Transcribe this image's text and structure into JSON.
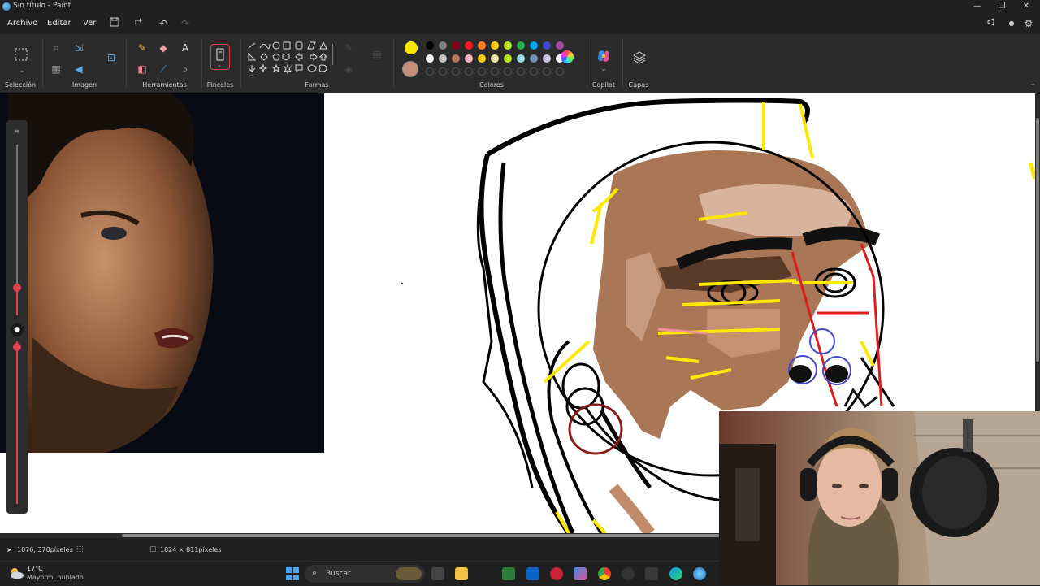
{
  "window": {
    "title": "Sin título - Paint"
  },
  "menu": {
    "file": "Archivo",
    "edit": "Editar",
    "view": "Ver"
  },
  "ribbon": {
    "groups": {
      "selection": "Selección",
      "image": "Imagen",
      "tools": "Herramientas",
      "brushes": "Pinceles",
      "shapes": "Formas",
      "colors": "Colores",
      "copilot": "Copilot",
      "layers": "Capas"
    },
    "primary_color": "#ffe800",
    "secondary_color": "#c2907b",
    "palette_row1": [
      "#000000",
      "#7f7f7f",
      "#880015",
      "#ed1c24",
      "#ff7f27",
      "#ffc90e",
      "#b5e61d",
      "#22b14c",
      "#00a2e8",
      "#3f48cc",
      "#a349a4"
    ],
    "palette_row2": [
      "#ffffff",
      "#c3c3c3",
      "#b97a57",
      "#ffaec9",
      "#ffc90e",
      "#efe4b0",
      "#b5e61d",
      "#99d9ea",
      "#7092be",
      "#c8bfe7",
      "#ffffff"
    ]
  },
  "status": {
    "cursor_position": "1076, 370píxeles",
    "canvas_size": "1824 × 811píxeles"
  },
  "taskbar": {
    "weather_temp": "17°C",
    "weather_desc": "Mayorm. nublado",
    "search_placeholder": "Buscar"
  }
}
